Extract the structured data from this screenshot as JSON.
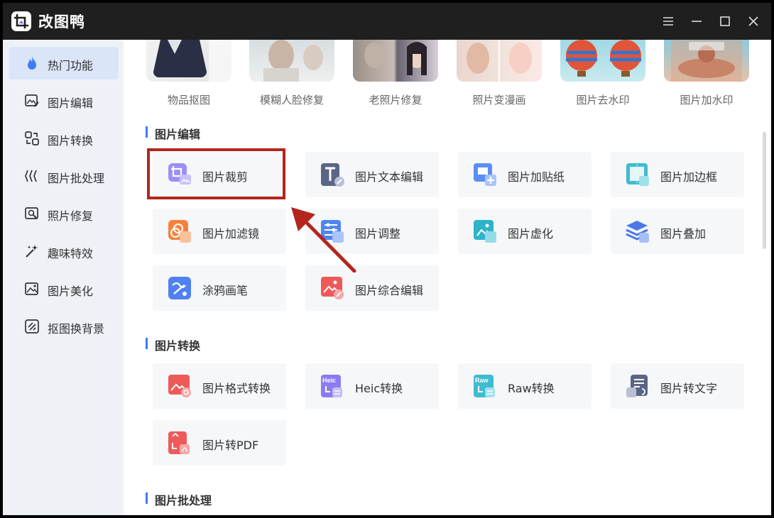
{
  "app": {
    "title": "改图鸭"
  },
  "sidebar": {
    "items": [
      {
        "label": "热门功能",
        "icon": "flame-icon"
      },
      {
        "label": "图片编辑",
        "icon": "image-edit-icon"
      },
      {
        "label": "图片转换",
        "icon": "convert-icon"
      },
      {
        "label": "图片批处理",
        "icon": "batch-icon"
      },
      {
        "label": "照片修复",
        "icon": "photo-repair-icon"
      },
      {
        "label": "趣味特效",
        "icon": "sparkle-icon"
      },
      {
        "label": "图片美化",
        "icon": "beautify-icon"
      },
      {
        "label": "抠图换背景",
        "icon": "cutout-icon"
      }
    ]
  },
  "hot": {
    "items": [
      {
        "label": "物品抠图"
      },
      {
        "label": "模糊人脸修复"
      },
      {
        "label": "老照片修复"
      },
      {
        "label": "照片变漫画"
      },
      {
        "label": "图片去水印"
      },
      {
        "label": "图片加水印"
      }
    ]
  },
  "sections": {
    "edit": {
      "title": "图片编辑",
      "items": [
        {
          "label": "图片裁剪",
          "icon": "crop-icon",
          "color": "#8a7cf0"
        },
        {
          "label": "图片文本编辑",
          "icon": "text-edit-icon",
          "color": "#5a6686"
        },
        {
          "label": "图片加贴纸",
          "icon": "sticker-icon",
          "color": "#5b8ef5"
        },
        {
          "label": "图片加边框",
          "icon": "frame-icon",
          "color": "#3fbcd0"
        },
        {
          "label": "图片加滤镜",
          "icon": "filter-icon",
          "color": "#f5813d"
        },
        {
          "label": "图片调整",
          "icon": "adjust-icon",
          "color": "#4f86f0"
        },
        {
          "label": "图片虚化",
          "icon": "blur-icon",
          "color": "#2db4c8"
        },
        {
          "label": "图片叠加",
          "icon": "layers-icon",
          "color": "#4a78e8"
        },
        {
          "label": "涂鸦画笔",
          "icon": "brush-icon",
          "color": "#4e82f2"
        },
        {
          "label": "图片综合编辑",
          "icon": "image-combo-icon",
          "color": "#ee5a5a"
        }
      ]
    },
    "convert": {
      "title": "图片转换",
      "items": [
        {
          "label": "图片格式转换",
          "icon": "format-convert-icon",
          "color": "#ee5a5a"
        },
        {
          "label": "Heic转换",
          "icon": "heic-icon",
          "color": "#8a7cf0",
          "badge": "Heic"
        },
        {
          "label": "Raw转换",
          "icon": "raw-icon",
          "color": "#3fbcd0",
          "badge": "Raw"
        },
        {
          "label": "图片转文字",
          "icon": "ocr-icon",
          "color": "#5a6686"
        },
        {
          "label": "图片转PDF",
          "icon": "pdf-icon",
          "color": "#ee5a5a"
        }
      ]
    },
    "batch": {
      "title": "图片批处理"
    }
  },
  "colors": {
    "accent": "#3d7bf7",
    "highlight": "#b3261e",
    "titlebar": "#1f1f1f"
  }
}
